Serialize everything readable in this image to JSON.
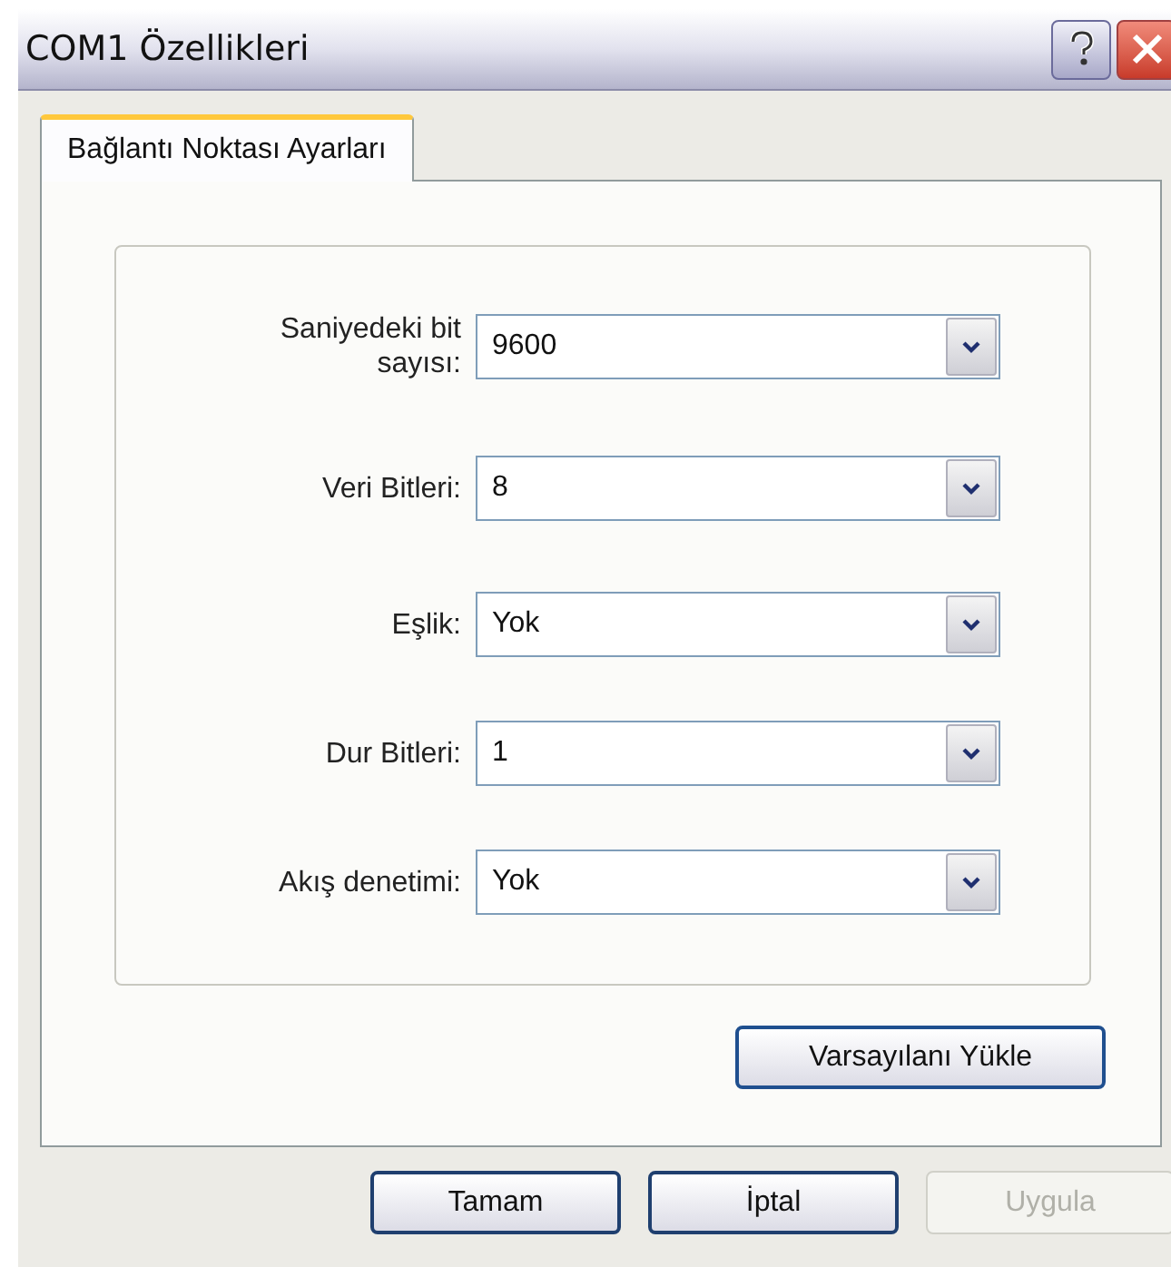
{
  "window": {
    "title": "COM1 Özellikleri"
  },
  "tabs": [
    {
      "label": "Bağlantı Noktası Ayarları",
      "selected": true
    }
  ],
  "fields": [
    {
      "label": "Saniyedeki bit sayısı:",
      "value": "9600"
    },
    {
      "label": "Veri Bitleri:",
      "value": "8"
    },
    {
      "label": "Eşlik:",
      "value": "Yok"
    },
    {
      "label": "Dur Bitleri:",
      "value": "1"
    },
    {
      "label": "Akış denetimi:",
      "value": "Yok"
    }
  ],
  "restore_button": {
    "label": "Varsayılanı Yükle"
  },
  "buttons": [
    {
      "label": "Tamam",
      "disabled": false
    },
    {
      "label": "İptal",
      "disabled": false
    },
    {
      "label": "Uygula",
      "disabled": true
    }
  ]
}
